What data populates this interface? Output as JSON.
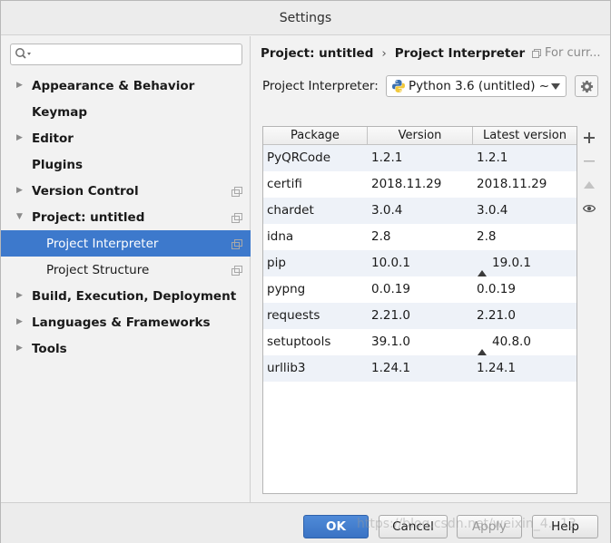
{
  "window": {
    "title": "Settings"
  },
  "search": {
    "placeholder": "",
    "value": ""
  },
  "sidebar": {
    "items": [
      {
        "label": "Appearance & Behavior",
        "arrow": "▶",
        "child": false
      },
      {
        "label": "Keymap",
        "arrow": "",
        "child": false
      },
      {
        "label": "Editor",
        "arrow": "▶",
        "child": false
      },
      {
        "label": "Plugins",
        "arrow": "",
        "child": false
      },
      {
        "label": "Version Control",
        "arrow": "▶",
        "child": false
      },
      {
        "label": "Project: untitled",
        "arrow": "▼",
        "child": false
      },
      {
        "label": "Project Interpreter",
        "arrow": "",
        "child": true
      },
      {
        "label": "Project Structure",
        "arrow": "",
        "child": true
      },
      {
        "label": "Build, Execution, Deployment",
        "arrow": "▶",
        "child": false
      },
      {
        "label": "Languages & Frameworks",
        "arrow": "▶",
        "child": false
      },
      {
        "label": "Tools",
        "arrow": "▶",
        "child": false
      }
    ]
  },
  "breadcrumb": {
    "parent": "Project: untitled",
    "separator": "›",
    "current": "Project Interpreter"
  },
  "for_current": "For curr...",
  "interpreter": {
    "label": "Project Interpreter:",
    "selected": "Python 3.6 (untitled) ~"
  },
  "table": {
    "headers": [
      "Package",
      "Version",
      "Latest version"
    ],
    "rows": [
      {
        "package": "PyQRCode",
        "version": "1.2.1",
        "latest": "1.2.1",
        "upgrade": false
      },
      {
        "package": "certifi",
        "version": "2018.11.29",
        "latest": "2018.11.29",
        "upgrade": false
      },
      {
        "package": "chardet",
        "version": "3.0.4",
        "latest": "3.0.4",
        "upgrade": false
      },
      {
        "package": "idna",
        "version": "2.8",
        "latest": "2.8",
        "upgrade": false
      },
      {
        "package": "pip",
        "version": "10.0.1",
        "latest": "19.0.1",
        "upgrade": true
      },
      {
        "package": "pypng",
        "version": "0.0.19",
        "latest": "0.0.19",
        "upgrade": false
      },
      {
        "package": "requests",
        "version": "2.21.0",
        "latest": "2.21.0",
        "upgrade": false
      },
      {
        "package": "setuptools",
        "version": "39.1.0",
        "latest": "40.8.0",
        "upgrade": true
      },
      {
        "package": "urllib3",
        "version": "1.24.1",
        "latest": "1.24.1",
        "upgrade": false
      }
    ]
  },
  "tools": {
    "add": "+",
    "remove": "−"
  },
  "footer": {
    "ok": "OK",
    "cancel": "Cancel",
    "apply": "Apply",
    "help": "Help"
  },
  "watermark": "https://blog.csdn.net/weixin_4...13",
  "colors": {
    "selection": "#3d79cc",
    "ok_button": "#3a73c4",
    "alt_row": "#eef2f8"
  },
  "icons": {
    "search": "search-icon",
    "copy": "copy-icon",
    "python": "python-icon",
    "gear": "gear-icon",
    "upgrade": "upgrade-arrow-icon",
    "add": "plus-icon",
    "remove": "minus-icon",
    "up": "triangle-up-icon",
    "eye": "eye-icon"
  }
}
